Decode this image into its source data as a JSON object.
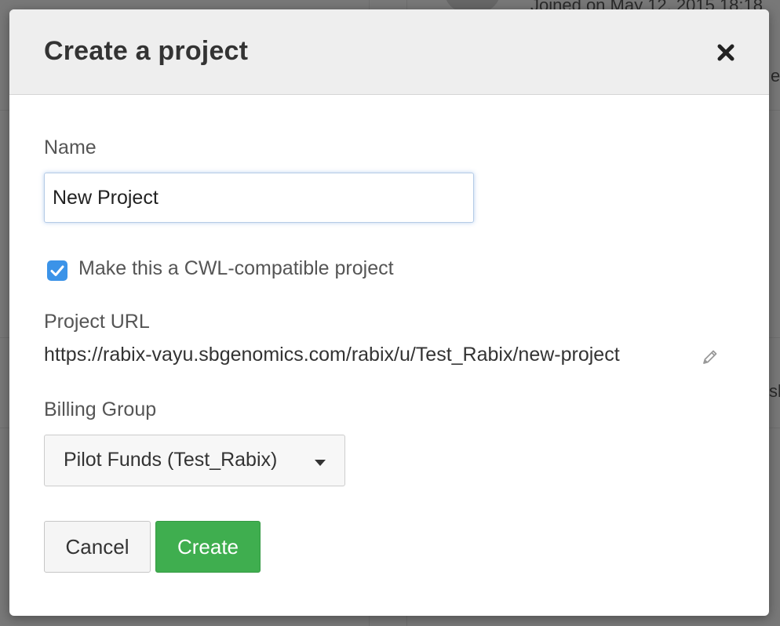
{
  "background": {
    "joined_text": "Joined on May 12, 2015 18:18",
    "partial_text_right_1": "e",
    "partial_text_right_2": "sk"
  },
  "modal": {
    "title": "Create a project",
    "close_icon": "close-x-icon"
  },
  "form": {
    "name_label": "Name",
    "name_value": "New Project",
    "cwl_checkbox_checked": true,
    "cwl_checkbox_label": "Make this a CWL-compatible project",
    "project_url_label": "Project URL",
    "project_url_value": "https://rabix-vayu.sbgenomics.com/rabix/u/Test_Rabix/new-project",
    "billing_group_label": "Billing Group",
    "billing_group_selected": "Pilot Funds (Test_Rabix)"
  },
  "buttons": {
    "cancel_label": "Cancel",
    "create_label": "Create"
  },
  "colors": {
    "create_button": "#3fae4f",
    "checkbox_accent": "#3b93e8",
    "header_bg": "#eeeeee"
  }
}
